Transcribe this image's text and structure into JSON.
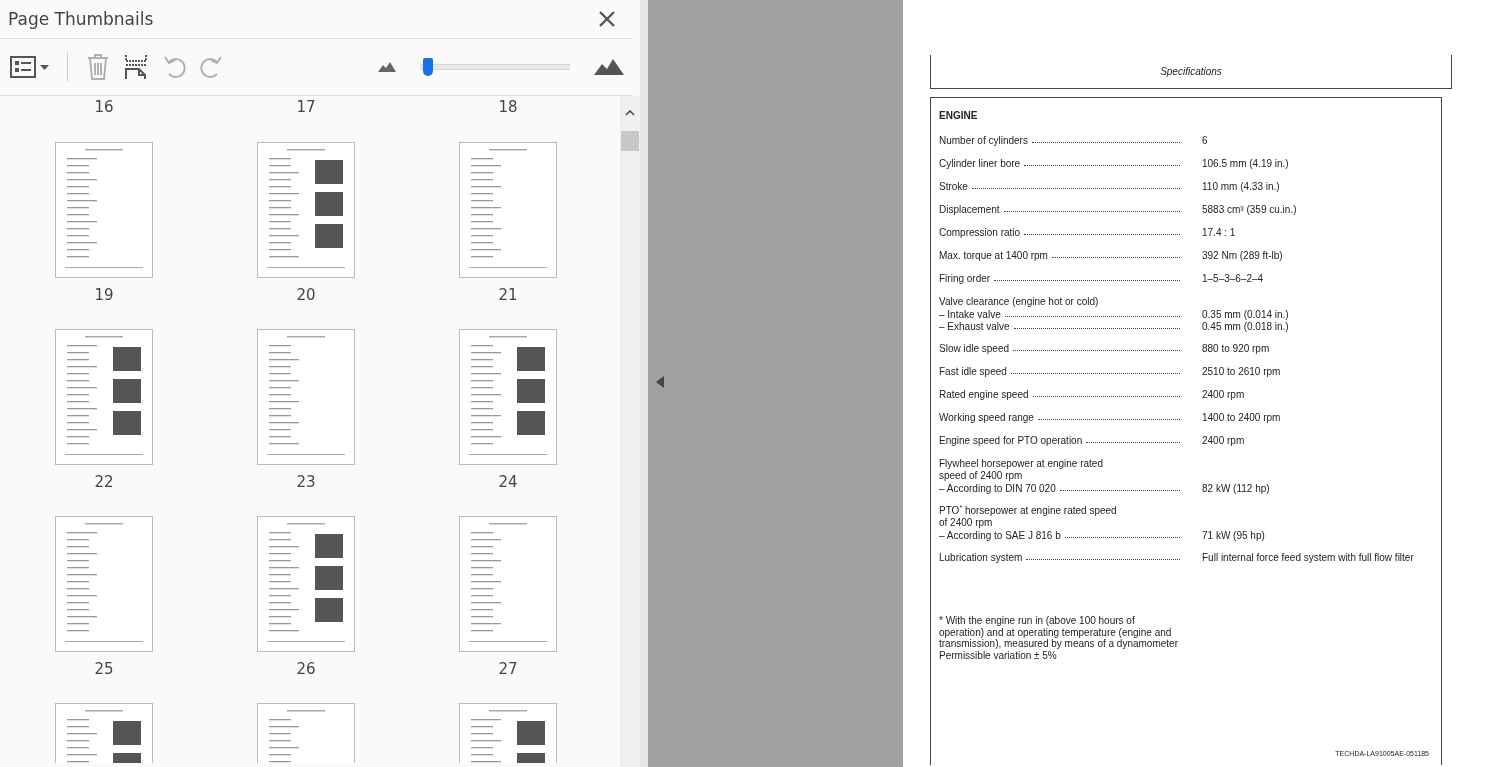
{
  "panel": {
    "title": "Page Thumbnails",
    "toolbar": [
      {
        "kind": "options",
        "disabled": false
      },
      {
        "kind": "delete",
        "disabled": true
      },
      {
        "kind": "insert",
        "disabled": false
      },
      {
        "kind": "rotate-left",
        "disabled": true
      },
      {
        "kind": "rotate-right",
        "disabled": true
      }
    ],
    "zoom_slider": {
      "level": 0.02
    },
    "top_labels": [
      "16",
      "17",
      "18"
    ],
    "pages": [
      {
        "label": "19"
      },
      {
        "label": "20"
      },
      {
        "label": "21"
      },
      {
        "label": "22"
      },
      {
        "label": "23"
      },
      {
        "label": "24"
      },
      {
        "label": "25"
      },
      {
        "label": "26"
      },
      {
        "label": "27"
      }
    ]
  },
  "document": {
    "header": "Specifications",
    "section": "ENGINE",
    "specs": [
      {
        "kind": "single",
        "label": "Number of cylinders",
        "value": "6"
      },
      {
        "kind": "single",
        "label": "Cylinder liner bore",
        "value": "106.5 mm (4.19 in.)"
      },
      {
        "kind": "single",
        "label": "Stroke",
        "value": "110 mm (4.33 in.)"
      },
      {
        "kind": "single",
        "label": "Displacement",
        "value": "5883 cm³ (359 cu.in.)"
      },
      {
        "kind": "single",
        "label": "Compression ratio",
        "value": "17.4 : 1"
      },
      {
        "kind": "single",
        "label": "Max. torque at 1400 rpm",
        "value": "392 Nm (289 ft-lb)"
      },
      {
        "kind": "single",
        "label": "Firing order",
        "value": "1–5–3–6–2–4"
      },
      {
        "kind": "group",
        "heading": [
          "Valve clearance (engine hot or cold)"
        ],
        "items": [
          {
            "label": "– Intake valve",
            "value": "0.35 mm (0.014 in.)"
          },
          {
            "label": "– Exhaust valve",
            "value": "0.45 mm (0.018 in.)"
          }
        ]
      },
      {
        "kind": "single",
        "label": "Slow idle speed",
        "value": "880 to 920 rpm"
      },
      {
        "kind": "single",
        "label": "Fast idle speed",
        "value": "2510 to 2610 rpm"
      },
      {
        "kind": "single",
        "label": "Rated engine speed",
        "value": "2400 rpm"
      },
      {
        "kind": "single",
        "label": "Working speed range",
        "value": "1400 to 2400 rpm"
      },
      {
        "kind": "single",
        "label": "Engine speed for PTO operation",
        "value": "2400 rpm"
      },
      {
        "kind": "group",
        "heading": [
          "Flywheel horsepower at engine rated",
          "speed of 2400 rpm"
        ],
        "items": [
          {
            "label": "– According to DIN 70 020",
            "value": "82 kW (112 hp)"
          }
        ]
      },
      {
        "kind": "group",
        "heading": [
          "PTO$^{*}$ horsepower at engine rated speed",
          "of 2400 rpm"
        ],
        "items": [
          {
            "label": "– According to SAE J 816 b",
            "value": "71 kW (95 hp)"
          }
        ]
      },
      {
        "kind": "single",
        "label": "Lubrication system",
        "value": "Full internal force feed system with full flow filter"
      }
    ],
    "footnote": [
      "* With the engine run in (above 100 hours of",
      "operation) and at operating temperature (engine and",
      "transmission), measured by means of a dynamometer",
      "Permissible variation ± 5%"
    ],
    "footer_code": "TECHDA-LA91005AE-051185"
  }
}
